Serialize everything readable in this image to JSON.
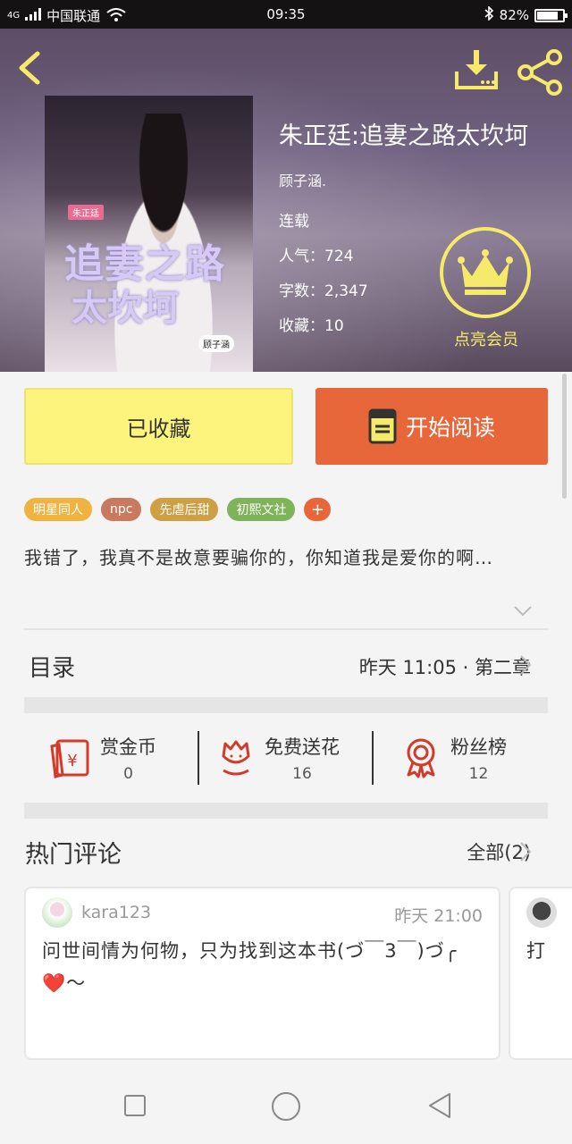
{
  "status_bar": {
    "network": "4G",
    "carrier": "中国联通",
    "time": "09:35",
    "battery": "82%",
    "battery_level": 0.82
  },
  "header": {
    "book_title": "朱正廷:追妻之路太坎坷",
    "author": "顾子涵.",
    "status": "连载",
    "popularity": "人气：724",
    "word_count": "字数：2,347",
    "favorites": "收藏：10",
    "vip_label": "点亮会员"
  },
  "cover": {
    "title_line1": "追妻之路",
    "title_line2": "太坎坷",
    "tag": "朱正廷",
    "signature": "顾子涵"
  },
  "actions": {
    "favorite_label": "已收藏",
    "read_label": "开始阅读"
  },
  "tags": [
    {
      "label": "明星同人",
      "color": "#f0b33f"
    },
    {
      "label": "npc",
      "color": "#c97a5e"
    },
    {
      "label": "先虐后甜",
      "color": "#cfa043"
    },
    {
      "label": "初熙文社",
      "color": "#7fb35a"
    }
  ],
  "tag_add": "+",
  "synopsis": "我错了，我真不是故意要骗你的，你知道我是爱你的啊…",
  "toc": {
    "title": "目录",
    "latest": "昨天 11:05 · 第二章"
  },
  "stats": [
    {
      "label": "赏金币",
      "value": "0",
      "icon": "red-envelope-icon"
    },
    {
      "label": "免费送花",
      "value": "16",
      "icon": "flower-icon"
    },
    {
      "label": "粉丝榜",
      "value": "12",
      "icon": "medal-icon"
    }
  ],
  "comments": {
    "title": "热门评论",
    "all_label": "全部(2)",
    "items": [
      {
        "user": "kara123",
        "time": "昨天 21:00",
        "text": "问世间情为何物，只为找到这本书(づ￣3￣)づ╭❤️～"
      },
      {
        "user": "",
        "time": "",
        "text": "打"
      }
    ]
  },
  "colors": {
    "accent_orange": "#e8673a",
    "favorite_yellow": "#fcf47c",
    "vip_gold": "#f6ea6a",
    "icon_red": "#d23a2a"
  }
}
